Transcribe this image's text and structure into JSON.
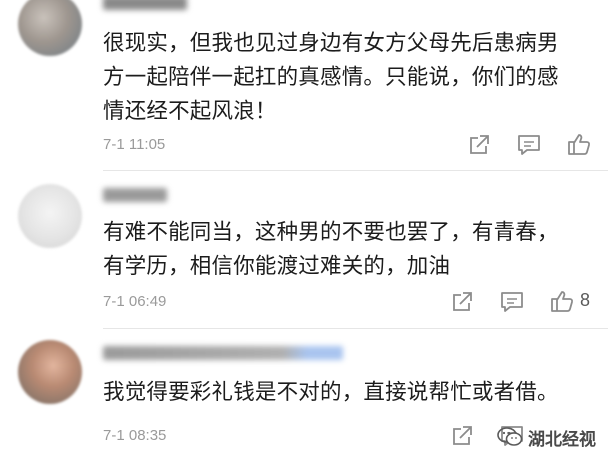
{
  "comments": [
    {
      "text": "很现实，但我也见过身边有女方父母先后患病男\n方一起陪伴一起扛的真感情。只能说，你们的感\n情还经不起风浪！",
      "time": "7-1 11:05",
      "likes": ""
    },
    {
      "text": "有难不能同当，这种男的不要也罢了，有青春，\n有学历，相信你能渡过难关的，加油",
      "time": "7-1 06:49",
      "likes": "8"
    },
    {
      "text": "我觉得要彩礼钱是不对的，直接说帮忙或者借。",
      "time": "7-1 08:35",
      "likes": ""
    }
  ],
  "icons": {
    "share": "share-icon",
    "reply": "reply-icon",
    "like": "like-icon"
  },
  "watermark": {
    "text": "湖北经视",
    "logo": "wechat-logo"
  },
  "colors": {
    "timestamp": "#9a9a9a",
    "icon": "#8c8c8c",
    "divider": "#e6e6e6"
  }
}
